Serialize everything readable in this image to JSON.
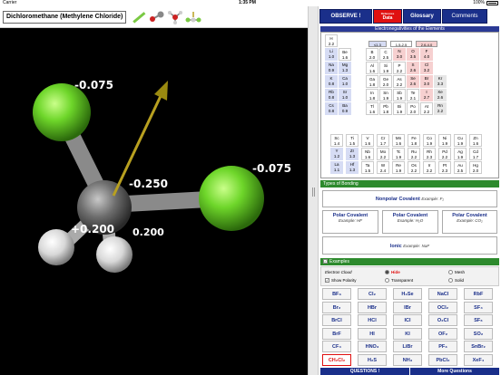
{
  "status": {
    "carrier": "Carrier",
    "time": "1:35 PM",
    "battery": "100%"
  },
  "molecule": {
    "name": "Dichloromethane (Methylene Chloride)"
  },
  "charges": {
    "cl_top": "-0.075",
    "cl_right": "-0.075",
    "carbon": "-0.250",
    "h_left": "+0.200",
    "h_right": "0.200"
  },
  "tabs": {
    "observe": "OBSERVE !",
    "data_top": "Reference",
    "data": "Data",
    "glossary": "Glossary",
    "comments": "Comments"
  },
  "ptable": {
    "title": "Electronegativities of the Elements",
    "legend": [
      "≤1.3",
      "1.5-2.5",
      "2.6-4.0"
    ],
    "elements": [
      {
        "s": "H",
        "v": "2.2",
        "c": "white",
        "col": 0,
        "row": 0
      },
      {
        "s": "Li",
        "v": "1.0",
        "c": "blue",
        "col": 0,
        "row": 1
      },
      {
        "s": "Be",
        "v": "1.6",
        "c": "white",
        "col": 1,
        "row": 1
      },
      {
        "s": "B",
        "v": "2.0",
        "c": "white",
        "col": 3,
        "row": 1
      },
      {
        "s": "C",
        "v": "2.5",
        "c": "white",
        "col": 4,
        "row": 1
      },
      {
        "s": "N",
        "v": "3.0",
        "c": "pink",
        "col": 5,
        "row": 1
      },
      {
        "s": "O",
        "v": "3.5",
        "c": "pink",
        "col": 6,
        "row": 1
      },
      {
        "s": "F",
        "v": "4.0",
        "c": "pink",
        "col": 7,
        "row": 1
      },
      {
        "s": "Na",
        "v": "0.9",
        "c": "blue",
        "col": 0,
        "row": 2
      },
      {
        "s": "Mg",
        "v": "1.3",
        "c": "blue",
        "col": 1,
        "row": 2
      },
      {
        "s": "Al",
        "v": "1.6",
        "c": "white",
        "col": 3,
        "row": 2
      },
      {
        "s": "Si",
        "v": "1.9",
        "c": "white",
        "col": 4,
        "row": 2
      },
      {
        "s": "P",
        "v": "2.2",
        "c": "white",
        "col": 5,
        "row": 2
      },
      {
        "s": "S",
        "v": "2.6",
        "c": "pink",
        "col": 6,
        "row": 2
      },
      {
        "s": "Cl",
        "v": "3.2",
        "c": "pink",
        "col": 7,
        "row": 2
      },
      {
        "s": "K",
        "v": "0.8",
        "c": "blue",
        "col": 0,
        "row": 3
      },
      {
        "s": "Ca",
        "v": "1.0",
        "c": "blue",
        "col": 1,
        "row": 3
      },
      {
        "s": "Ga",
        "v": "1.8",
        "c": "white",
        "col": 3,
        "row": 3
      },
      {
        "s": "Ge",
        "v": "2.0",
        "c": "white",
        "col": 4,
        "row": 3
      },
      {
        "s": "As",
        "v": "2.2",
        "c": "white",
        "col": 5,
        "row": 3
      },
      {
        "s": "Se",
        "v": "2.6",
        "c": "pink",
        "col": 6,
        "row": 3
      },
      {
        "s": "Br",
        "v": "3.0",
        "c": "pink",
        "col": 7,
        "row": 3
      },
      {
        "s": "Kr",
        "v": "3.3",
        "c": "gray",
        "col": 8,
        "row": 3
      },
      {
        "s": "Rb",
        "v": "0.8",
        "c": "blue",
        "col": 0,
        "row": 4
      },
      {
        "s": "Sr",
        "v": "1.0",
        "c": "blue",
        "col": 1,
        "row": 4
      },
      {
        "s": "In",
        "v": "1.8",
        "c": "white",
        "col": 3,
        "row": 4
      },
      {
        "s": "Sn",
        "v": "1.9",
        "c": "white",
        "col": 4,
        "row": 4
      },
      {
        "s": "Sb",
        "v": "1.9",
        "c": "white",
        "col": 5,
        "row": 4
      },
      {
        "s": "Te",
        "v": "2.1",
        "c": "white",
        "col": 6,
        "row": 4
      },
      {
        "s": "I",
        "v": "2.7",
        "c": "pink",
        "col": 7,
        "row": 4
      },
      {
        "s": "Xe",
        "v": "2.6",
        "c": "gray",
        "col": 8,
        "row": 4
      },
      {
        "s": "Cs",
        "v": "0.8",
        "c": "blue",
        "col": 0,
        "row": 5
      },
      {
        "s": "Ba",
        "v": "0.9",
        "c": "blue",
        "col": 1,
        "row": 5
      },
      {
        "s": "Tl",
        "v": "1.6",
        "c": "white",
        "col": 3,
        "row": 5
      },
      {
        "s": "Pb",
        "v": "1.8",
        "c": "white",
        "col": 4,
        "row": 5
      },
      {
        "s": "Bi",
        "v": "1.9",
        "c": "white",
        "col": 5,
        "row": 5
      },
      {
        "s": "Po",
        "v": "2.0",
        "c": "white",
        "col": 6,
        "row": 5
      },
      {
        "s": "At",
        "v": "2.2",
        "c": "white",
        "col": 7,
        "row": 5
      },
      {
        "s": "Rn",
        "v": "2.2",
        "c": "gray",
        "col": 8,
        "row": 5
      }
    ],
    "transition": [
      {
        "s": "Sc",
        "v": "1.4",
        "c": "white",
        "col": 0,
        "row": 0
      },
      {
        "s": "Ti",
        "v": "1.5",
        "c": "white",
        "col": 1,
        "row": 0
      },
      {
        "s": "V",
        "v": "1.6",
        "c": "white",
        "col": 2,
        "row": 0
      },
      {
        "s": "Cr",
        "v": "1.7",
        "c": "white",
        "col": 3,
        "row": 0
      },
      {
        "s": "Mn",
        "v": "1.6",
        "c": "white",
        "col": 4,
        "row": 0
      },
      {
        "s": "Fe",
        "v": "1.8",
        "c": "white",
        "col": 5,
        "row": 0
      },
      {
        "s": "Co",
        "v": "1.9",
        "c": "white",
        "col": 6,
        "row": 0
      },
      {
        "s": "Ni",
        "v": "1.9",
        "c": "white",
        "col": 7,
        "row": 0
      },
      {
        "s": "Cu",
        "v": "1.9",
        "c": "white",
        "col": 8,
        "row": 0
      },
      {
        "s": "Zn",
        "v": "1.6",
        "c": "white",
        "col": 9,
        "row": 0
      },
      {
        "s": "Y",
        "v": "1.2",
        "c": "blue",
        "col": 0,
        "row": 1
      },
      {
        "s": "Zr",
        "v": "1.3",
        "c": "blue",
        "col": 1,
        "row": 1
      },
      {
        "s": "Nb",
        "v": "1.6",
        "c": "white",
        "col": 2,
        "row": 1
      },
      {
        "s": "Mo",
        "v": "2.2",
        "c": "white",
        "col": 3,
        "row": 1
      },
      {
        "s": "Tc",
        "v": "1.9",
        "c": "white",
        "col": 4,
        "row": 1
      },
      {
        "s": "Ru",
        "v": "2.2",
        "c": "white",
        "col": 5,
        "row": 1
      },
      {
        "s": "Rh",
        "v": "2.3",
        "c": "white",
        "col": 6,
        "row": 1
      },
      {
        "s": "Pd",
        "v": "2.2",
        "c": "white",
        "col": 7,
        "row": 1
      },
      {
        "s": "Ag",
        "v": "1.9",
        "c": "white",
        "col": 8,
        "row": 1
      },
      {
        "s": "Cd",
        "v": "1.7",
        "c": "white",
        "col": 9,
        "row": 1
      },
      {
        "s": "La",
        "v": "1.1",
        "c": "blue",
        "col": 0,
        "row": 2
      },
      {
        "s": "Hf",
        "v": "1.3",
        "c": "blue",
        "col": 1,
        "row": 2
      },
      {
        "s": "Ta",
        "v": "1.5",
        "c": "white",
        "col": 2,
        "row": 2
      },
      {
        "s": "W",
        "v": "2.4",
        "c": "white",
        "col": 3,
        "row": 2
      },
      {
        "s": "Re",
        "v": "1.9",
        "c": "white",
        "col": 4,
        "row": 2
      },
      {
        "s": "Os",
        "v": "2.2",
        "c": "white",
        "col": 5,
        "row": 2
      },
      {
        "s": "Ir",
        "v": "2.2",
        "c": "white",
        "col": 6,
        "row": 2
      },
      {
        "s": "Pt",
        "v": "2.3",
        "c": "white",
        "col": 7,
        "row": 2
      },
      {
        "s": "Au",
        "v": "2.5",
        "c": "white",
        "col": 8,
        "row": 2
      },
      {
        "s": "Hg",
        "v": "2.0",
        "c": "white",
        "col": 9,
        "row": 2
      }
    ]
  },
  "bonding": {
    "title": "Types of Bonding",
    "nonpolar": "Nonpolar Covalent",
    "nonpolar_ex_label": "Example:",
    "nonpolar_ex": "F₂",
    "polar": "Polar Covalent",
    "ex_label": "Example:",
    "polar1_ex": "HF",
    "polar2_ex": "H₂O",
    "polar3_ex": "CO₂",
    "ionic": "Ionic",
    "ionic_ex_label": "Example:",
    "ionic_ex": "NaF"
  },
  "examples": {
    "title": "Examples",
    "electron_cloud": "Electron Cloud",
    "show_polarity": "Show Polarity",
    "hide": "Hide",
    "mesh": "Mesh",
    "transparent": "Transparent",
    "solid": "Solid",
    "molecules": [
      "BF₃",
      "Cl₂",
      "H₂Se",
      "NaCl",
      "RbF",
      "Br₂",
      "HBr",
      "IBr",
      "OCl₂",
      "SF₄",
      "BrCl",
      "HCl",
      "ICl",
      "O₂Cl",
      "SF₆",
      "BrF",
      "HI",
      "KI",
      "OF₂",
      "SO₂",
      "CF₄",
      "HNO₃",
      "LiBr",
      "PF₃",
      "SnBr₂",
      "CH₂Cl₂",
      "H₂S",
      "NH₃",
      "PbCl₂",
      "XeF₄"
    ],
    "selected": "CH₂Cl₂"
  },
  "bottom": {
    "questions": "QUESTIONS !",
    "more": "More Questions"
  },
  "colors": {
    "navy": "#1a2f8a",
    "red": "#e01010",
    "green": "#2d8a2d",
    "chlorine": "#6ed62a",
    "carbon": "#6e6e6e",
    "hydrogen": "#e6e6e6",
    "arrow": "#b8a020"
  }
}
